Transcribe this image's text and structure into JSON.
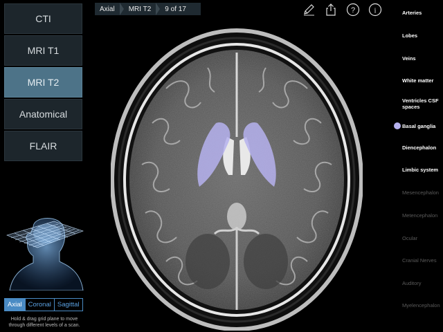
{
  "modes": [
    {
      "label": "CTI",
      "active": false
    },
    {
      "label": "MRI T1",
      "active": false
    },
    {
      "label": "MRI T2",
      "active": true
    },
    {
      "label": "Anatomical",
      "active": false
    },
    {
      "label": "FLAIR",
      "active": false
    }
  ],
  "breadcrumb": {
    "plane": "Axial",
    "mode": "MRI T2",
    "slice": "9 of 17"
  },
  "view_tabs": [
    {
      "label": "Axial",
      "active": true
    },
    {
      "label": "Coronal",
      "active": false
    },
    {
      "label": "Sagittal",
      "active": false
    }
  ],
  "hint": "Hold & drag grid plane to move through different levels of a scan.",
  "toolbar": {
    "icons": [
      "pencil-icon",
      "share-icon",
      "help-icon",
      "info-icon"
    ],
    "help_glyph": "?",
    "info_glyph": "i"
  },
  "structures": [
    {
      "label": "Arteries",
      "enabled": true,
      "selected": false
    },
    {
      "label": "Lobes",
      "enabled": true,
      "selected": false
    },
    {
      "label": "Veins",
      "enabled": true,
      "selected": false
    },
    {
      "label": "White matter",
      "enabled": true,
      "selected": false
    },
    {
      "label": "Ventricles CSF spaces",
      "enabled": true,
      "selected": false
    },
    {
      "label": "Basal ganglia",
      "enabled": true,
      "selected": true
    },
    {
      "label": "Diencephalon",
      "enabled": true,
      "selected": false
    },
    {
      "label": "Limbic system",
      "enabled": true,
      "selected": false
    },
    {
      "label": "Mesencephalon",
      "enabled": false,
      "selected": false
    },
    {
      "label": "Metencephalon",
      "enabled": false,
      "selected": false
    },
    {
      "label": "Ocular",
      "enabled": false,
      "selected": false
    },
    {
      "label": "Cranial Nerves",
      "enabled": false,
      "selected": false
    },
    {
      "label": "Auditory",
      "enabled": false,
      "selected": false
    },
    {
      "label": "Myelencephalon",
      "enabled": false,
      "selected": false
    }
  ],
  "colors": {
    "highlight": "#b6b2ef",
    "active_mode": "#4d7388",
    "tab_accent": "#4a8bc4"
  }
}
